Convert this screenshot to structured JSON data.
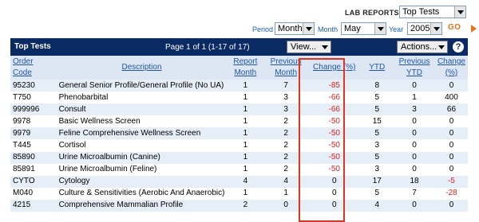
{
  "header": {
    "lab_reports_label": "LAB REPORTS",
    "report_select": "Top Tests"
  },
  "filters": {
    "period_label": "Period",
    "period_value": "Month",
    "month_label": "Month",
    "month_value": "May",
    "year_label": "Year",
    "year_value": "2005",
    "go_label": "GO"
  },
  "panel": {
    "title": "Top Tests",
    "pager": "Page 1 of 1 (1-17 of 17)",
    "view_label": "View...",
    "actions_label": "Actions...",
    "help_label": "?"
  },
  "table": {
    "columns": [
      "Order Code",
      "Description",
      "Report Month",
      "Previous Month",
      "Change (%)",
      "YTD",
      "Previous YTD",
      "Change (%)"
    ],
    "rows": [
      [
        "95230",
        "General Senior Profile/General Profile (No UA)",
        "1",
        "7",
        "-85",
        "8",
        "0",
        "0"
      ],
      [
        "T750",
        "Phenobarbital",
        "1",
        "3",
        "-66",
        "5",
        "1",
        "400"
      ],
      [
        "999996",
        "Consult",
        "1",
        "3",
        "-66",
        "5",
        "3",
        "66"
      ],
      [
        "9978",
        "Basic Wellness Screen",
        "1",
        "2",
        "-50",
        "15",
        "0",
        "0"
      ],
      [
        "9979",
        "Feline Comprehensive Wellness Screen",
        "1",
        "2",
        "-50",
        "5",
        "0",
        "0"
      ],
      [
        "T445",
        "Cortisol",
        "1",
        "2",
        "-50",
        "3",
        "0",
        "0"
      ],
      [
        "85890",
        "Urine Microalbumin (Canine)",
        "1",
        "2",
        "-50",
        "5",
        "0",
        "0"
      ],
      [
        "85891",
        "Urine Microalbumin (Feline)",
        "1",
        "2",
        "-50",
        "3",
        "0",
        "0"
      ],
      [
        "CYTO",
        "Cytology",
        "4",
        "4",
        "0",
        "17",
        "18",
        "-5"
      ],
      [
        "M040",
        "Culture & Sensitivities (Aerobic And Anaerobic)",
        "1",
        "1",
        "0",
        "5",
        "7",
        "-28"
      ],
      [
        "4215",
        "Comprehensive Mammalian Profile",
        "2",
        "0",
        "0",
        "4",
        "0",
        "0"
      ]
    ]
  },
  "colors": {
    "header_bg": "#0a2a63",
    "negative": "#e02020",
    "highlight_border": "#e0351f",
    "go": "#e8731a"
  }
}
